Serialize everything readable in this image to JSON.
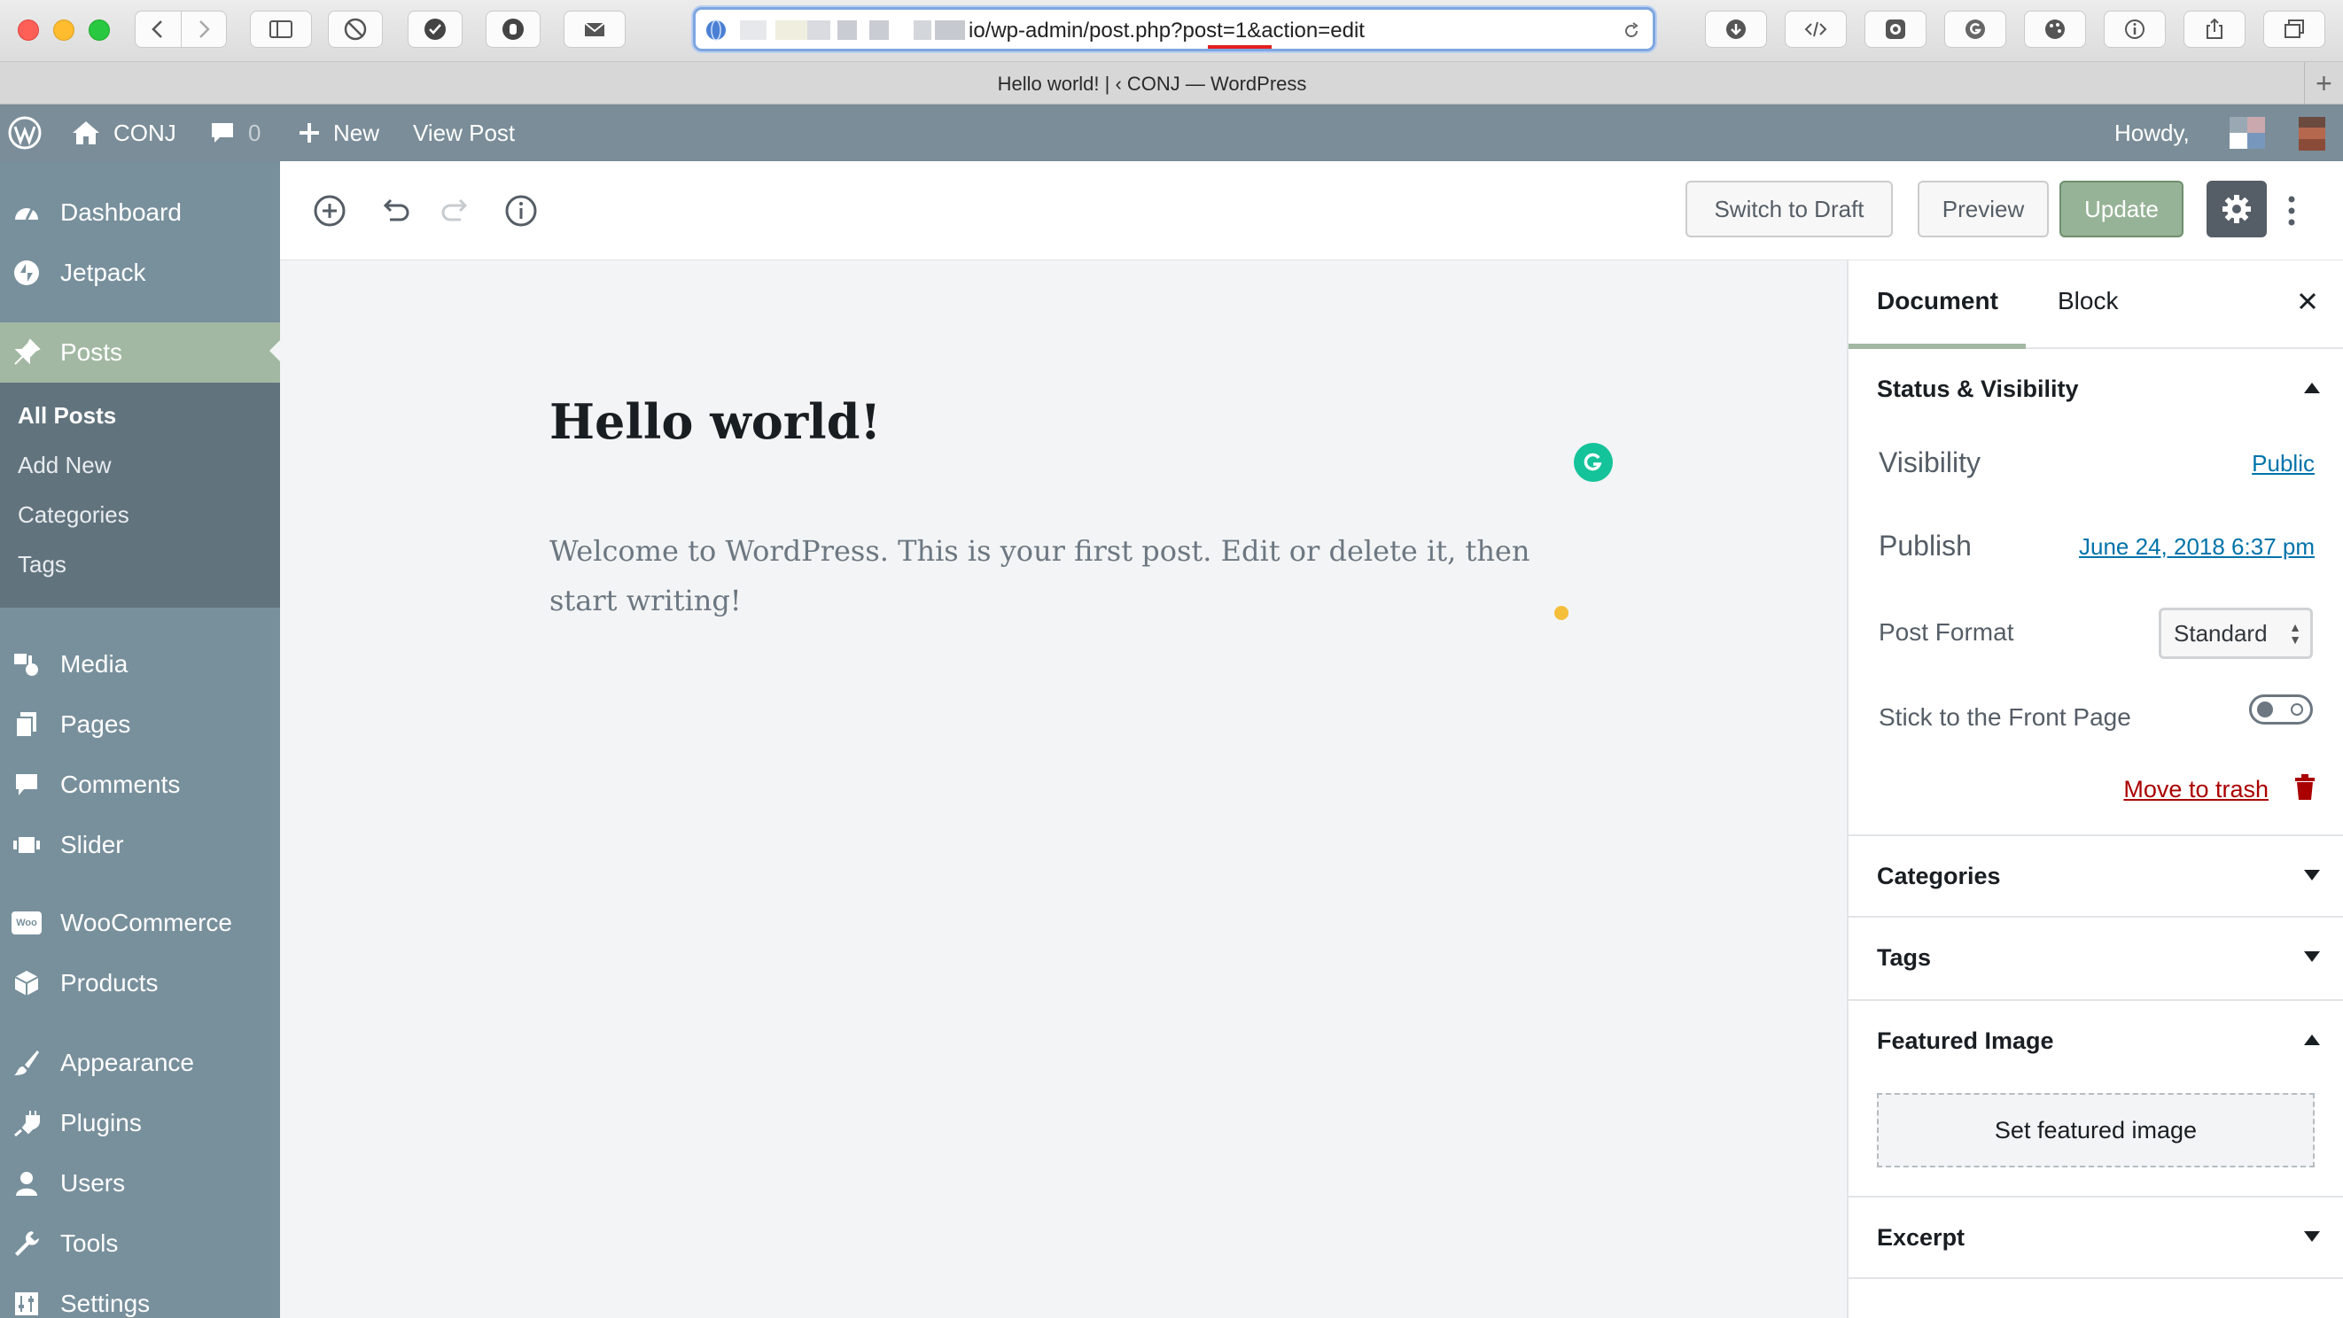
{
  "browser": {
    "url": "io/wp-admin/post.php?post=1&action=edit",
    "tab_title": "Hello world! | ‹ CONJ — WordPress",
    "new_tab": "+"
  },
  "admin_bar": {
    "site_name": "CONJ",
    "comments_count": "0",
    "new_label": "New",
    "view_post_label": "View Post",
    "howdy": "Howdy,"
  },
  "menu": {
    "dashboard": "Dashboard",
    "jetpack": "Jetpack",
    "posts": "Posts",
    "sub": [
      "All Posts",
      "Add New",
      "Categories",
      "Tags"
    ],
    "media": "Media",
    "pages": "Pages",
    "comments": "Comments",
    "slider": "Slider",
    "woocommerce": "WooCommerce",
    "woo_badge": "Woo",
    "products": "Products",
    "appearance": "Appearance",
    "plugins": "Plugins",
    "users": "Users",
    "tools": "Tools",
    "settings": "Settings"
  },
  "toolbar": {
    "switch_to_draft": "Switch to Draft",
    "preview": "Preview",
    "update": "Update"
  },
  "post": {
    "title": "Hello world!",
    "body": "Welcome to WordPress. This is your first post. Edit or delete it, then start writing!"
  },
  "sidebar": {
    "tabs": [
      "Document",
      "Block"
    ],
    "status_visibility": "Status & Visibility",
    "visibility_label": "Visibility",
    "visibility_value": "Public",
    "publish_label": "Publish",
    "publish_value": "June 24, 2018 6:37 pm",
    "post_format_label": "Post Format",
    "post_format_value": "Standard",
    "sticky_label": "Stick to the Front Page",
    "move_to_trash": "Move to trash",
    "categories": "Categories",
    "tags": "Tags",
    "featured_image": "Featured Image",
    "set_featured_image": "Set featured image",
    "excerpt": "Excerpt"
  },
  "colors": {
    "admin_bar": "#7a8d98",
    "menu_bg": "#78909c",
    "menu_current": "#a3b8a3",
    "update_button": "#97b397",
    "link": "#0073aa",
    "trash": "#aa0000"
  }
}
